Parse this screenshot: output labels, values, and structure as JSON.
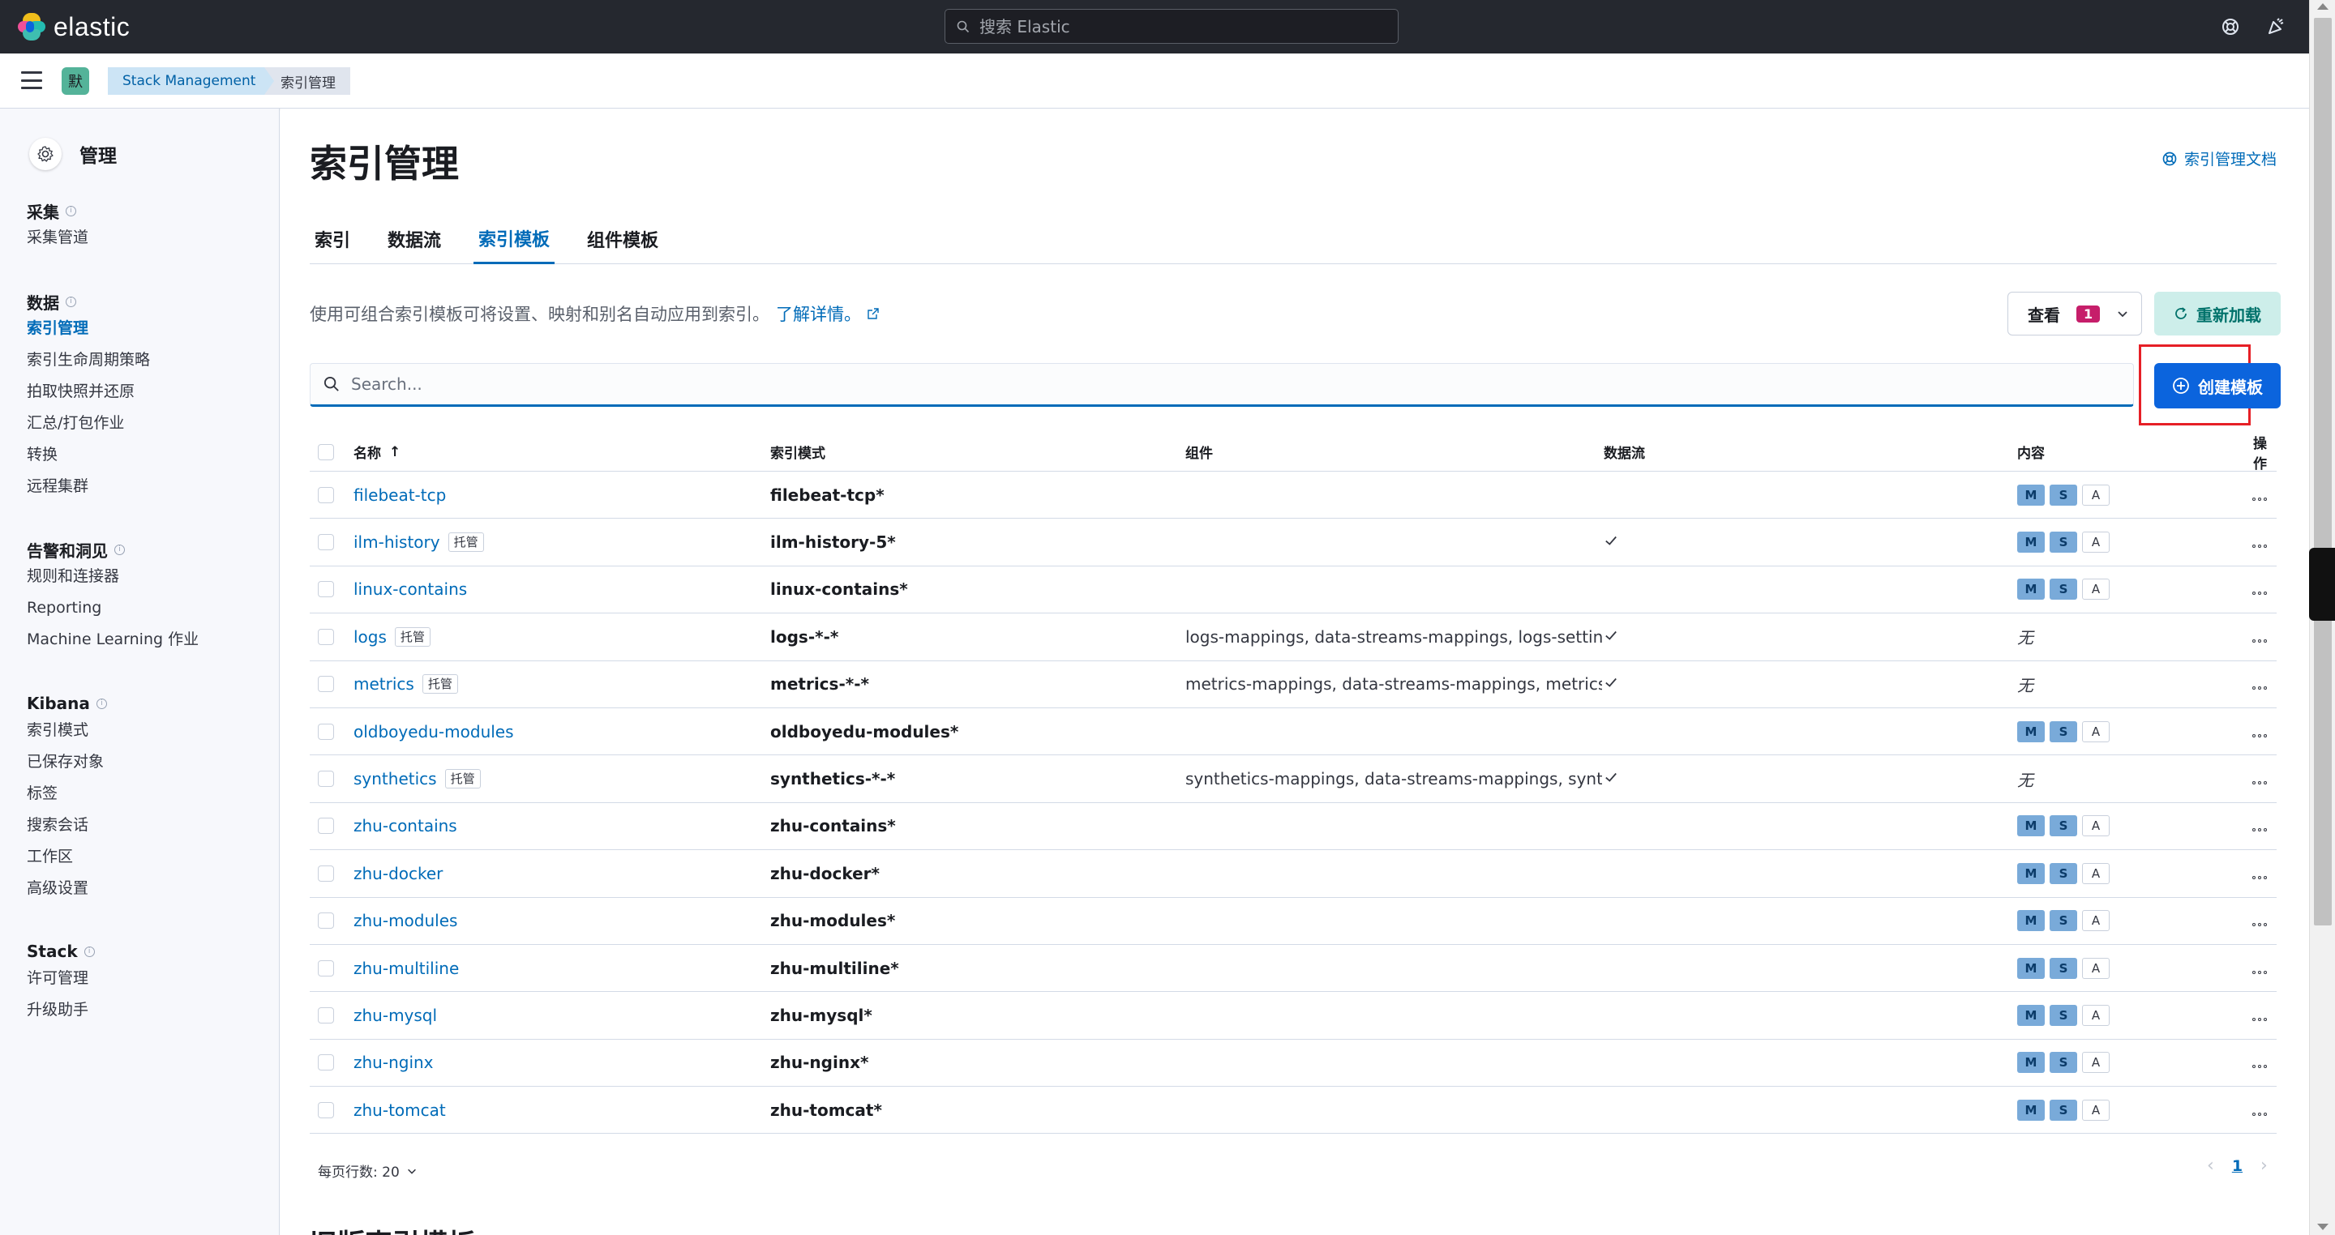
{
  "header": {
    "brand": "elastic",
    "search_placeholder": "搜索 Elastic"
  },
  "breadcrumbs": {
    "space_initial": "默",
    "items": [
      "Stack Management",
      "索引管理"
    ]
  },
  "sidebar": {
    "title": "管理",
    "groups": [
      {
        "title": "采集",
        "items": [
          {
            "label": "采集管道",
            "active": false
          }
        ]
      },
      {
        "title": "数据",
        "items": [
          {
            "label": "索引管理",
            "active": true
          },
          {
            "label": "索引生命周期策略",
            "active": false
          },
          {
            "label": "拍取快照并还原",
            "active": false
          },
          {
            "label": "汇总/打包作业",
            "active": false
          },
          {
            "label": "转换",
            "active": false
          },
          {
            "label": "远程集群",
            "active": false
          }
        ]
      },
      {
        "title": "告警和洞见",
        "items": [
          {
            "label": "规则和连接器",
            "active": false
          },
          {
            "label": "Reporting",
            "active": false
          },
          {
            "label": "Machine Learning 作业",
            "active": false
          }
        ]
      },
      {
        "title": "Kibana",
        "items": [
          {
            "label": "索引模式",
            "active": false
          },
          {
            "label": "已保存对象",
            "active": false
          },
          {
            "label": "标签",
            "active": false
          },
          {
            "label": "搜索会话",
            "active": false
          },
          {
            "label": "工作区",
            "active": false
          },
          {
            "label": "高级设置",
            "active": false
          }
        ]
      },
      {
        "title": "Stack",
        "items": [
          {
            "label": "许可管理",
            "active": false
          },
          {
            "label": "升级助手",
            "active": false
          }
        ]
      }
    ]
  },
  "main": {
    "title": "索引管理",
    "doc_link": "索引管理文档",
    "tabs": [
      {
        "label": "索引",
        "active": false
      },
      {
        "label": "数据流",
        "active": false
      },
      {
        "label": "索引模板",
        "active": true
      },
      {
        "label": "组件模板",
        "active": false
      }
    ],
    "description": "使用可组合索引模板可将设置、映射和别名自动应用到索引。",
    "learn_more": "了解详情。",
    "view_button": "查看",
    "view_count": "1",
    "reload_button": "重新加载",
    "search_placeholder": "Search...",
    "create_button": "创建模板",
    "table": {
      "columns": [
        "名称",
        "索引模式",
        "组件",
        "数据流",
        "内容",
        "操作"
      ],
      "sort_indicator": "↑",
      "rows": [
        {
          "name": "filebeat-tcp",
          "managed": false,
          "pattern": "filebeat-tcp*",
          "components": "",
          "data_stream": false,
          "content": [
            "M",
            "S",
            "A"
          ]
        },
        {
          "name": "ilm-history",
          "managed": true,
          "pattern": "ilm-history-5*",
          "components": "",
          "data_stream": true,
          "content": [
            "M",
            "S",
            "A"
          ]
        },
        {
          "name": "linux-contains",
          "managed": false,
          "pattern": "linux-contains*",
          "components": "",
          "data_stream": false,
          "content": [
            "M",
            "S",
            "A"
          ]
        },
        {
          "name": "logs",
          "managed": true,
          "pattern": "logs-*-*",
          "components": "logs-mappings, data-streams-mappings, logs-settings",
          "data_stream": true,
          "content": []
        },
        {
          "name": "metrics",
          "managed": true,
          "pattern": "metrics-*-*",
          "components": "metrics-mappings, data-streams-mappings, metrics-s",
          "data_stream": true,
          "content": []
        },
        {
          "name": "oldboyedu-modules",
          "managed": false,
          "pattern": "oldboyedu-modules*",
          "components": "",
          "data_stream": false,
          "content": [
            "M",
            "S",
            "A"
          ]
        },
        {
          "name": "synthetics",
          "managed": true,
          "pattern": "synthetics-*-*",
          "components": "synthetics-mappings, data-streams-mappings, synthe",
          "data_stream": true,
          "content": []
        },
        {
          "name": "zhu-contains",
          "managed": false,
          "pattern": "zhu-contains*",
          "components": "",
          "data_stream": false,
          "content": [
            "M",
            "S",
            "A"
          ]
        },
        {
          "name": "zhu-docker",
          "managed": false,
          "pattern": "zhu-docker*",
          "components": "",
          "data_stream": false,
          "content": [
            "M",
            "S",
            "A"
          ]
        },
        {
          "name": "zhu-modules",
          "managed": false,
          "pattern": "zhu-modules*",
          "components": "",
          "data_stream": false,
          "content": [
            "M",
            "S",
            "A"
          ]
        },
        {
          "name": "zhu-multiline",
          "managed": false,
          "pattern": "zhu-multiline*",
          "components": "",
          "data_stream": false,
          "content": [
            "M",
            "S",
            "A"
          ]
        },
        {
          "name": "zhu-mysql",
          "managed": false,
          "pattern": "zhu-mysql*",
          "components": "",
          "data_stream": false,
          "content": [
            "M",
            "S",
            "A"
          ]
        },
        {
          "name": "zhu-nginx",
          "managed": false,
          "pattern": "zhu-nginx*",
          "components": "",
          "data_stream": false,
          "content": [
            "M",
            "S",
            "A"
          ]
        },
        {
          "name": "zhu-tomcat",
          "managed": false,
          "pattern": "zhu-tomcat*",
          "components": "",
          "data_stream": false,
          "content": [
            "M",
            "S",
            "A"
          ]
        }
      ],
      "managed_label": "托管",
      "none_label": "无"
    },
    "rows_per_page": "每页行数: 20",
    "pagination": {
      "current": "1"
    },
    "next_section_title": "旧版索引模板"
  }
}
